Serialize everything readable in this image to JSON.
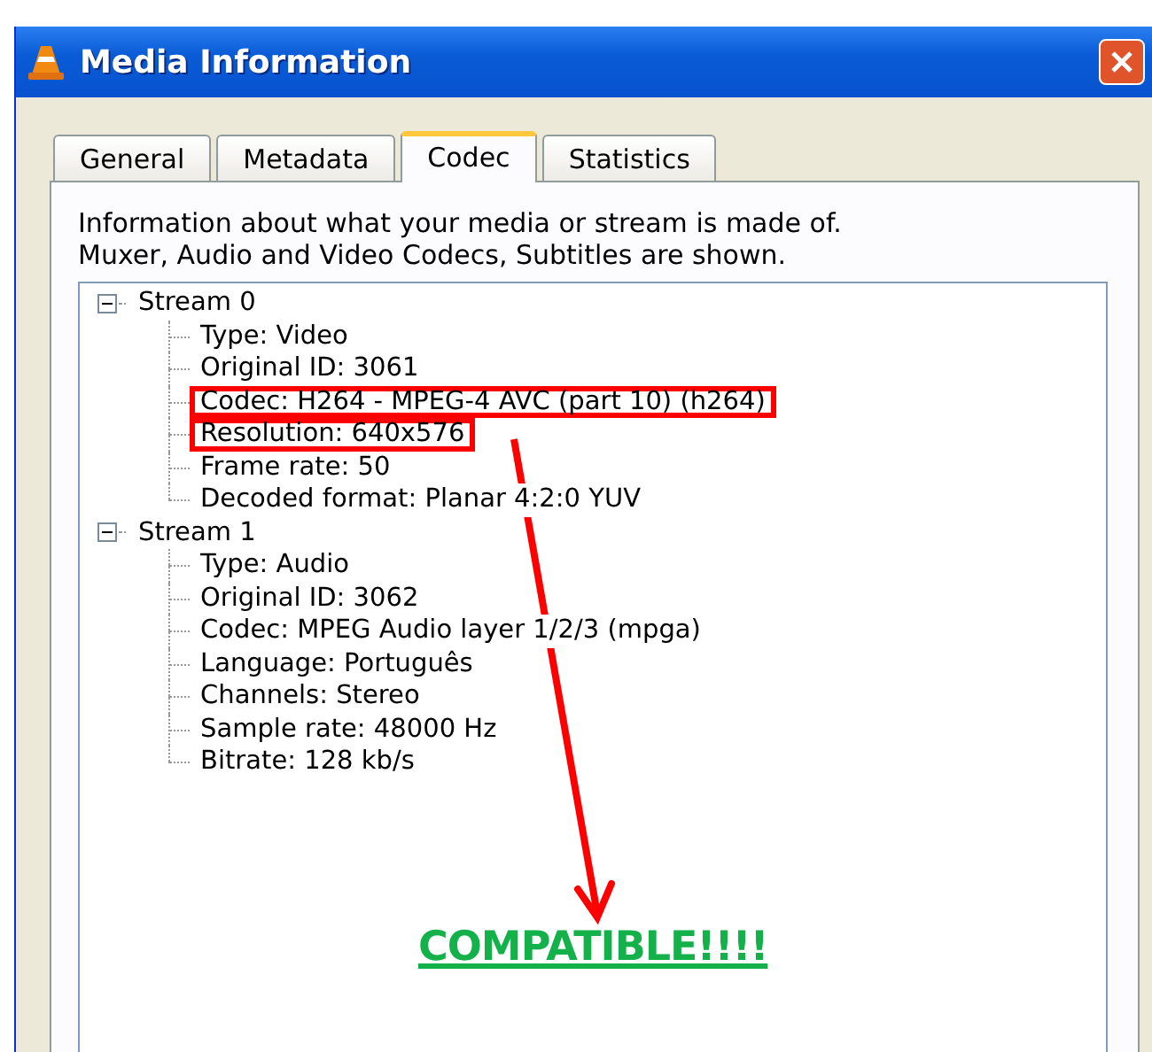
{
  "window": {
    "title": "Media Information"
  },
  "tabs": [
    {
      "label": "General",
      "selected": false
    },
    {
      "label": "Metadata",
      "selected": false
    },
    {
      "label": "Codec",
      "selected": true
    },
    {
      "label": "Statistics",
      "selected": false
    }
  ],
  "description": [
    "Information about what your media or stream is made of.",
    "Muxer, Audio and Video Codecs, Subtitles are shown."
  ],
  "tree": [
    {
      "label": "Stream 0",
      "expanded": true,
      "children": [
        {
          "label": "Type: Video",
          "highlighted": false
        },
        {
          "label": "Original ID: 3061",
          "highlighted": false
        },
        {
          "label": "Codec: H264 - MPEG-4 AVC (part 10) (h264)",
          "highlighted": true
        },
        {
          "label": "Resolution: 640x576",
          "highlighted": true
        },
        {
          "label": "Frame rate: 50",
          "highlighted": false
        },
        {
          "label": "Decoded format: Planar 4:2:0 YUV",
          "highlighted": false
        }
      ]
    },
    {
      "label": "Stream 1",
      "expanded": true,
      "children": [
        {
          "label": "Type: Audio",
          "highlighted": false
        },
        {
          "label": "Original ID: 3062",
          "highlighted": false
        },
        {
          "label": "Codec: MPEG Audio layer 1/2/3 (mpga)",
          "highlighted": false
        },
        {
          "label": "Language: Português",
          "highlighted": false
        },
        {
          "label": "Channels: Stereo",
          "highlighted": false
        },
        {
          "label": "Sample rate: 48000 Hz",
          "highlighted": false
        },
        {
          "label": "Bitrate: 128 kb/s",
          "highlighted": false
        }
      ]
    }
  ],
  "annotation": {
    "text": "COMPATIBLE!!!!"
  }
}
